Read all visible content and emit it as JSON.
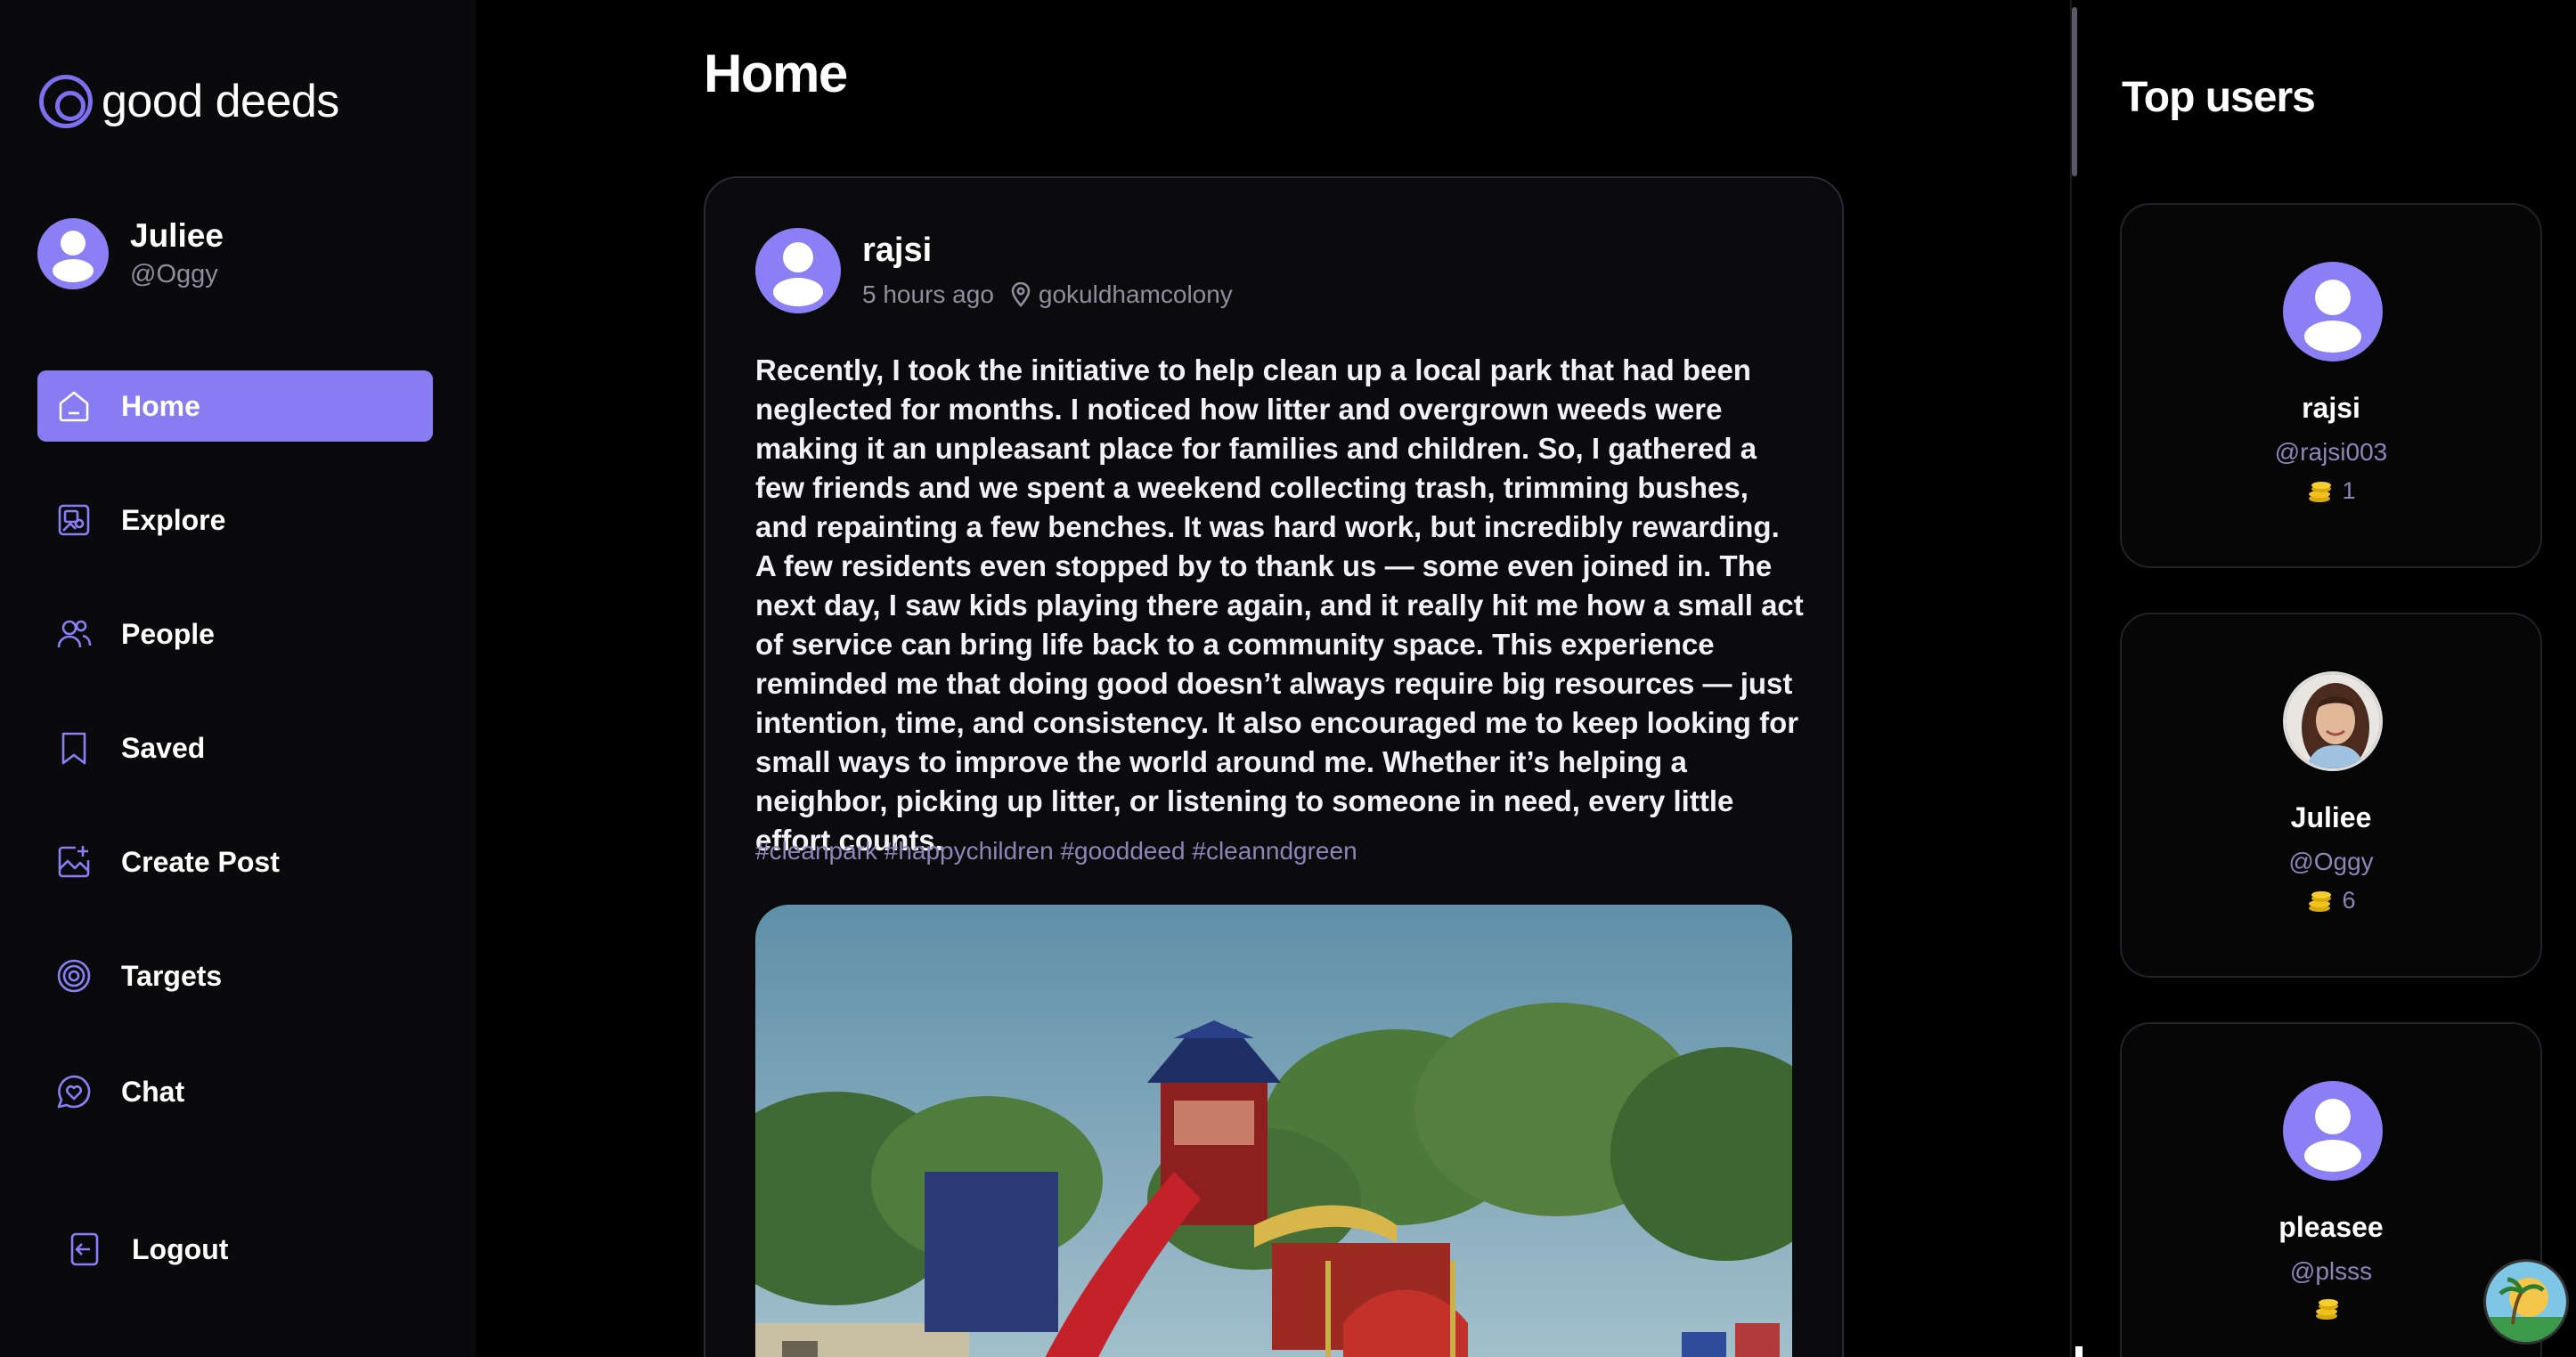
{
  "brand": {
    "name": "good deeds"
  },
  "current_user": {
    "name": "Juliee",
    "handle": "@Oggy"
  },
  "nav": {
    "items": [
      {
        "label": "Home",
        "icon": "home-icon",
        "active": true
      },
      {
        "label": "Explore",
        "icon": "explore-icon"
      },
      {
        "label": "People",
        "icon": "people-icon"
      },
      {
        "label": "Saved",
        "icon": "bookmark-icon"
      },
      {
        "label": "Create Post",
        "icon": "create-post-icon"
      },
      {
        "label": "Targets",
        "icon": "target-icon"
      },
      {
        "label": "Chat",
        "icon": "chat-icon"
      }
    ],
    "logout_label": "Logout"
  },
  "main": {
    "title": "Home"
  },
  "post": {
    "author": "rajsi",
    "time": "5 hours ago",
    "location": "gokuldhamcolony",
    "body": "Recently, I took the initiative to help clean up a local park that had been neglected for months. I noticed how litter and overgrown weeds were making it an unpleasant place for families and children. So, I gathered a few friends and we spent a weekend collecting trash, trimming bushes, and repainting a few benches. It was hard work, but incredibly rewarding. A few residents even stopped by to thank us — some even joined in. The next day, I saw kids playing there again, and it really hit me how a small act of service can bring life back to a community space. This experience reminded me that doing good doesn’t always require big resources — just intention, time, and consistency. It also encouraged me to keep looking for small ways to improve the world around me. Whether it’s helping a neighbor, picking up litter, or listening to someone in need, every little effort counts.",
    "tags": "#cleanpark #happychildren #gooddeed #cleanndgreen"
  },
  "top_users": {
    "title": "Top users",
    "users": [
      {
        "name": "rajsi",
        "handle": "@rajsi003",
        "coins": "1"
      },
      {
        "name": "Juliee",
        "handle": "@Oggy",
        "coins": "6"
      },
      {
        "name": "pleasee",
        "handle": "@plsss",
        "coins": ""
      }
    ]
  },
  "colors": {
    "accent": "#877cf2",
    "background": "#000000",
    "sidebar": "#0a0a0c",
    "muted": "#8f8f9c",
    "coin": "#f5c518"
  }
}
